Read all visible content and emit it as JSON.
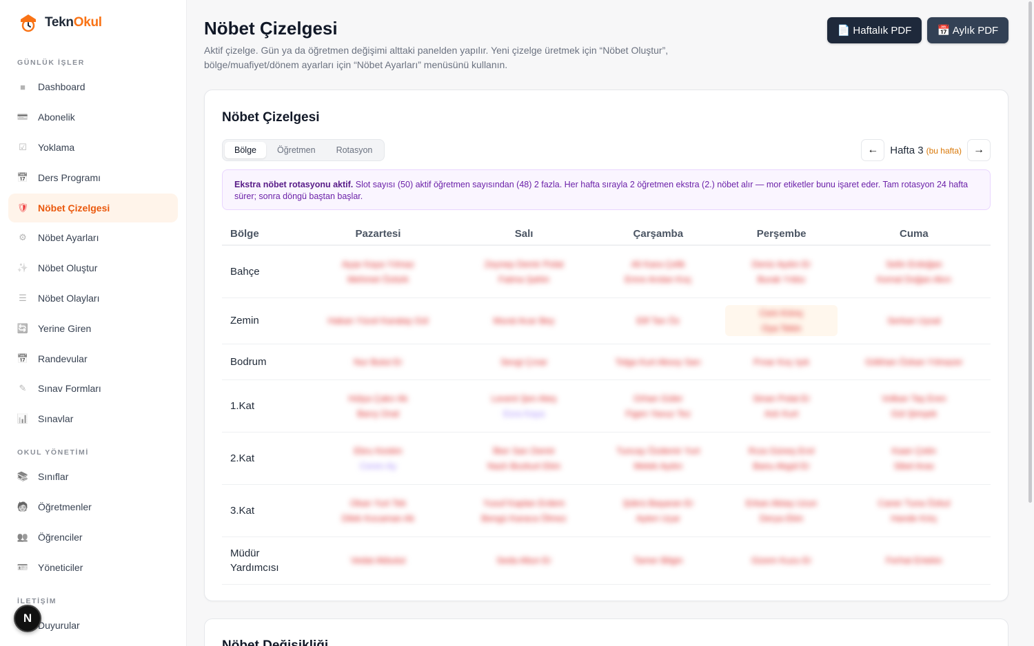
{
  "brand": {
    "part1": "Tekn",
    "part2": "Okul"
  },
  "sidebar": {
    "section1": "GÜNLÜK İŞLER",
    "section2": "OKUL YÖNETİMİ",
    "section3": "İLETİŞİM",
    "items": [
      {
        "label": "Dashboard",
        "icon": "dashboard-icon",
        "glyph": "■"
      },
      {
        "label": "Abonelik",
        "icon": "card-icon",
        "glyph": "💳"
      },
      {
        "label": "Yoklama",
        "icon": "check-icon",
        "glyph": "☑"
      },
      {
        "label": "Ders Programı",
        "icon": "calendar-icon",
        "glyph": "📅"
      },
      {
        "label": "Nöbet Çizelgesi",
        "icon": "shield-icon",
        "glyph": "🛡"
      },
      {
        "label": "Nöbet Ayarları",
        "icon": "gear-icon",
        "glyph": "⚙"
      },
      {
        "label": "Nöbet Oluştur",
        "icon": "sparkle-icon",
        "glyph": "✨"
      },
      {
        "label": "Nöbet Olayları",
        "icon": "list-icon",
        "glyph": "☰"
      },
      {
        "label": "Yerine Giren",
        "icon": "swap-icon",
        "glyph": "🔄"
      },
      {
        "label": "Randevular",
        "icon": "calendar-icon",
        "glyph": "📅"
      },
      {
        "label": "Sınav Formları",
        "icon": "pencil-icon",
        "glyph": "✎"
      },
      {
        "label": "Sınavlar",
        "icon": "bar-chart-icon",
        "glyph": "📊"
      },
      {
        "label": "Sınıflar",
        "icon": "classroom-icon",
        "glyph": "📚"
      },
      {
        "label": "Öğretmenler",
        "icon": "teacher-icon",
        "glyph": "🧑"
      },
      {
        "label": "Öğrenciler",
        "icon": "students-icon",
        "glyph": "👥"
      },
      {
        "label": "Yöneticiler",
        "icon": "id-card-icon",
        "glyph": "🪪"
      },
      {
        "label": "Duyurular",
        "icon": "megaphone-icon",
        "glyph": "📢"
      }
    ],
    "fab": "N"
  },
  "header": {
    "title": "Nöbet Çizelgesi",
    "subtitle": "Aktif çizelge. Gün ya da öğretmen değişimi alttaki panelden yapılır. Yeni çizelge üretmek için “Nöbet Oluştur”, bölge/muafiyet/dönem ayarları için “Nöbet Ayarları” menüsünü kullanın.",
    "weekly_pdf": "📄 Haftalık PDF",
    "monthly_pdf": "📅 Aylık PDF"
  },
  "card": {
    "title": "Nöbet Çizelgesi",
    "tabs": [
      "Bölge",
      "Öğretmen",
      "Rotasyon"
    ],
    "prev": "←",
    "next": "→",
    "week_label": "Hafta 3",
    "week_tag": "(bu hafta)",
    "notice_bold": "Ekstra nöbet rotasyonu aktif.",
    "notice_text": " Slot sayısı (50) aktif öğretmen sayısından (48) 2 fazla. Her hafta sırayla 2 öğretmen ekstra (2.) nöbet alır — mor etiketler bunu işaret eder. Tam rotasyon 24 hafta sürer; sonra döngü baştan başlar."
  },
  "table": {
    "headers": [
      "Bölge",
      "Pazartesi",
      "Salı",
      "Çarşamba",
      "Perşembe",
      "Cuma"
    ],
    "rows": [
      {
        "zone": "Bahçe",
        "cells": [
          [
            "Ayşe Kaya Yılmaz",
            "Mehmet Öztürk"
          ],
          [
            "Zeynep Demir Polat",
            "Fatma Şahin"
          ],
          [
            "Ali Kara Çelik",
            "Emre Arslan Koç"
          ],
          [
            "Deniz Aydın Er",
            "Burak Yıldız"
          ],
          [
            "Selin Erdoğan",
            "Kemal Doğan Akın"
          ]
        ]
      },
      {
        "zone": "Zemin",
        "cells": [
          [
            "Hakan Yücel Karataş Gül"
          ],
          [
            "Murat Acar Bey"
          ],
          [
            "Elif Tan Öz"
          ],
          [
            "Cem Kılınç",
            "Oya Tekin"
          ],
          [
            "Serkan Uysal"
          ]
        ]
      },
      {
        "zone": "Bodrum",
        "cells": [
          [
            "Nur Bulut Er"
          ],
          [
            "Sevgi Çınar"
          ],
          [
            "Tolga Kurt Aksoy Sarı"
          ],
          [
            "Pınar Koç Işık"
          ],
          [
            "Gökhan Özkan Yılmazer"
          ]
        ]
      },
      {
        "zone": "1.Kat",
        "cells": [
          [
            "Hülya Çakır Ak",
            "Barış Ünal"
          ],
          [
            "Levent Şen Ateş",
            "Esra Kaya"
          ],
          [
            "Orhan Güler",
            "Figen Yavuz Tez"
          ],
          [
            "Sinan Polat Er",
            "Aslı Kurt"
          ],
          [
            "Volkan Taş Eren",
            "Gül Şimşek"
          ]
        ]
      },
      {
        "zone": "2.Kat",
        "cells": [
          [
            "Ebru Keskin",
            "Ceren Ay"
          ],
          [
            "İlker Sarı Demir",
            "Nazlı Bozkurt Ekin"
          ],
          [
            "Tuncay Özdemir Yurt",
            "Melek Aydın"
          ],
          [
            "Rıza Güneş Erol",
            "Banu Akgül Er"
          ],
          [
            "Kaan Çetin",
            "Sibel Aras"
          ]
        ]
      },
      {
        "zone": "3.Kat",
        "cells": [
          [
            "Okan Yurt Tek",
            "Dilek Kocaman Ak"
          ],
          [
            "Yusuf Kaplan Erdem",
            "Bengü Karaca Ölmez"
          ],
          [
            "Şükrü Başaran Er",
            "Ayten Uçar"
          ],
          [
            "Erkan Aktaş Uzun",
            "Derya Ekin"
          ],
          [
            "Caner Tuna Özkul",
            "Hande Kılıç"
          ]
        ]
      },
      {
        "zone": "Müdür Yardımcısı",
        "cells": [
          [
            "Vedat Akbulut"
          ],
          [
            "Seda Altun Er"
          ],
          [
            "Tamer Bilgin"
          ],
          [
            "Gizem Kuzu Er"
          ],
          [
            "Ferhat Ertekin"
          ]
        ]
      }
    ]
  },
  "card2": {
    "title": "Nöbet Değişikliği"
  }
}
